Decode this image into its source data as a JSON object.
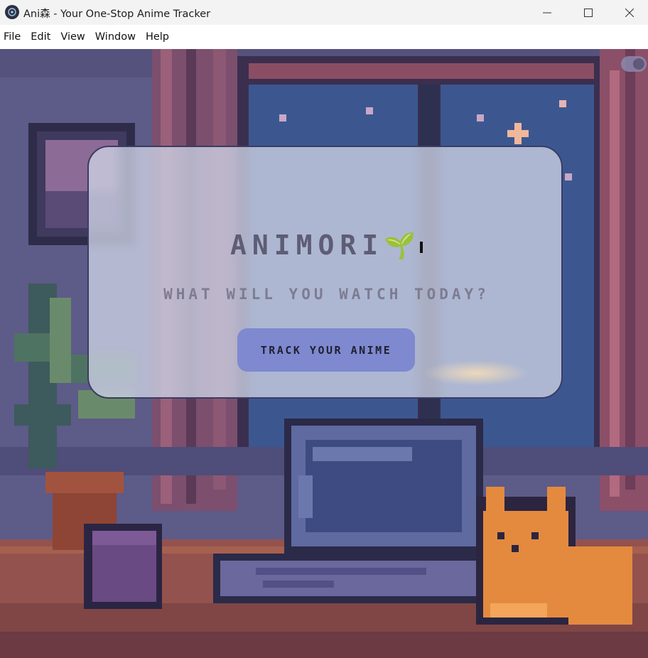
{
  "window": {
    "title": "Ani森 - Your One-Stop Anime Tracker",
    "controls": {
      "minimize": "minimize-icon",
      "maximize": "maximize-icon",
      "close": "close-icon"
    }
  },
  "menu": {
    "items": [
      {
        "label": "File"
      },
      {
        "label": "Edit"
      },
      {
        "label": "View"
      },
      {
        "label": "Window"
      },
      {
        "label": "Help"
      }
    ]
  },
  "hero": {
    "title": "ANIMORI",
    "title_emoji": "🌱",
    "subtitle": "WHAT WILL YOU WATCH TODAY?",
    "cta_label": "TRACK YOUR ANIME"
  },
  "theme_toggle": {
    "state": "dark",
    "icon": "toggle-icon"
  },
  "colors": {
    "card_background": "#ced3e4",
    "cta_background": "#7f89cf",
    "heading_text": "#5e5d75",
    "scene_background": "#5b5986"
  }
}
